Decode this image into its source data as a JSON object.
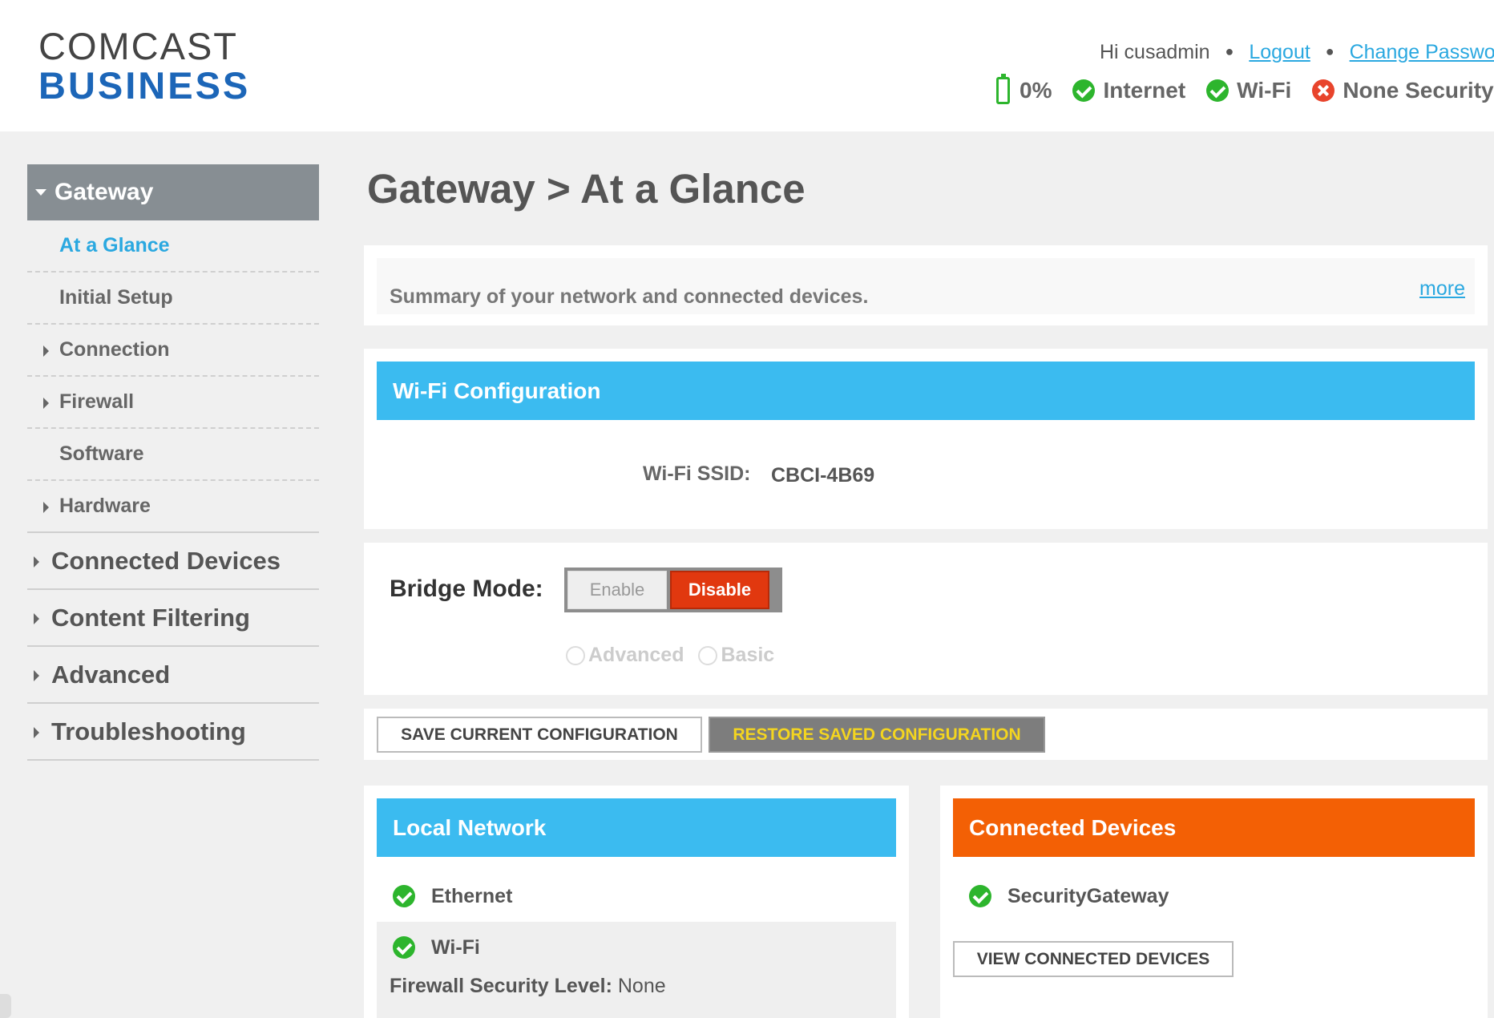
{
  "header": {
    "logo_line1": "COMCAST",
    "logo_line2": "BUSINESS",
    "greeting": "Hi cusadmin",
    "logout": "Logout",
    "change_password": "Change Password",
    "battery": "0%",
    "internet": "Internet",
    "wifi": "Wi-Fi",
    "security": "None Security"
  },
  "sidebar": {
    "gateway": "Gateway",
    "sub_items": [
      "At a Glance",
      "Initial Setup",
      "Connection",
      "Firewall",
      "Software",
      "Hardware"
    ],
    "main_items": [
      "Connected Devices",
      "Content Filtering",
      "Advanced",
      "Troubleshooting"
    ]
  },
  "page": {
    "title": "Gateway > At a Glance",
    "summary": "Summary of your network and connected devices.",
    "more": "more"
  },
  "wifi_config": {
    "header": "Wi-Fi Configuration",
    "ssid_label": "Wi-Fi SSID:",
    "ssid_value": "CBCI-4B69"
  },
  "bridge": {
    "label": "Bridge Mode:",
    "enable": "Enable",
    "disable": "Disable",
    "option_advanced": "Advanced",
    "option_basic": "Basic"
  },
  "actions": {
    "save": "SAVE CURRENT CONFIGURATION",
    "restore": "RESTORE SAVED CONFIGURATION"
  },
  "local_network": {
    "header": "Local Network",
    "ethernet": "Ethernet",
    "wifi": "Wi-Fi",
    "fw_label": "Firewall Security Level:",
    "fw_value": "None"
  },
  "connected_devices": {
    "header": "Connected Devices",
    "device": "SecurityGateway",
    "view_button": "VIEW CONNECTED DEVICES"
  },
  "colors": {
    "accent_blue": "#3bbbf0",
    "accent_orange": "#f36005",
    "disable_red": "#e1380f",
    "ok_green": "#2db52d",
    "err_red": "#e8442c"
  }
}
